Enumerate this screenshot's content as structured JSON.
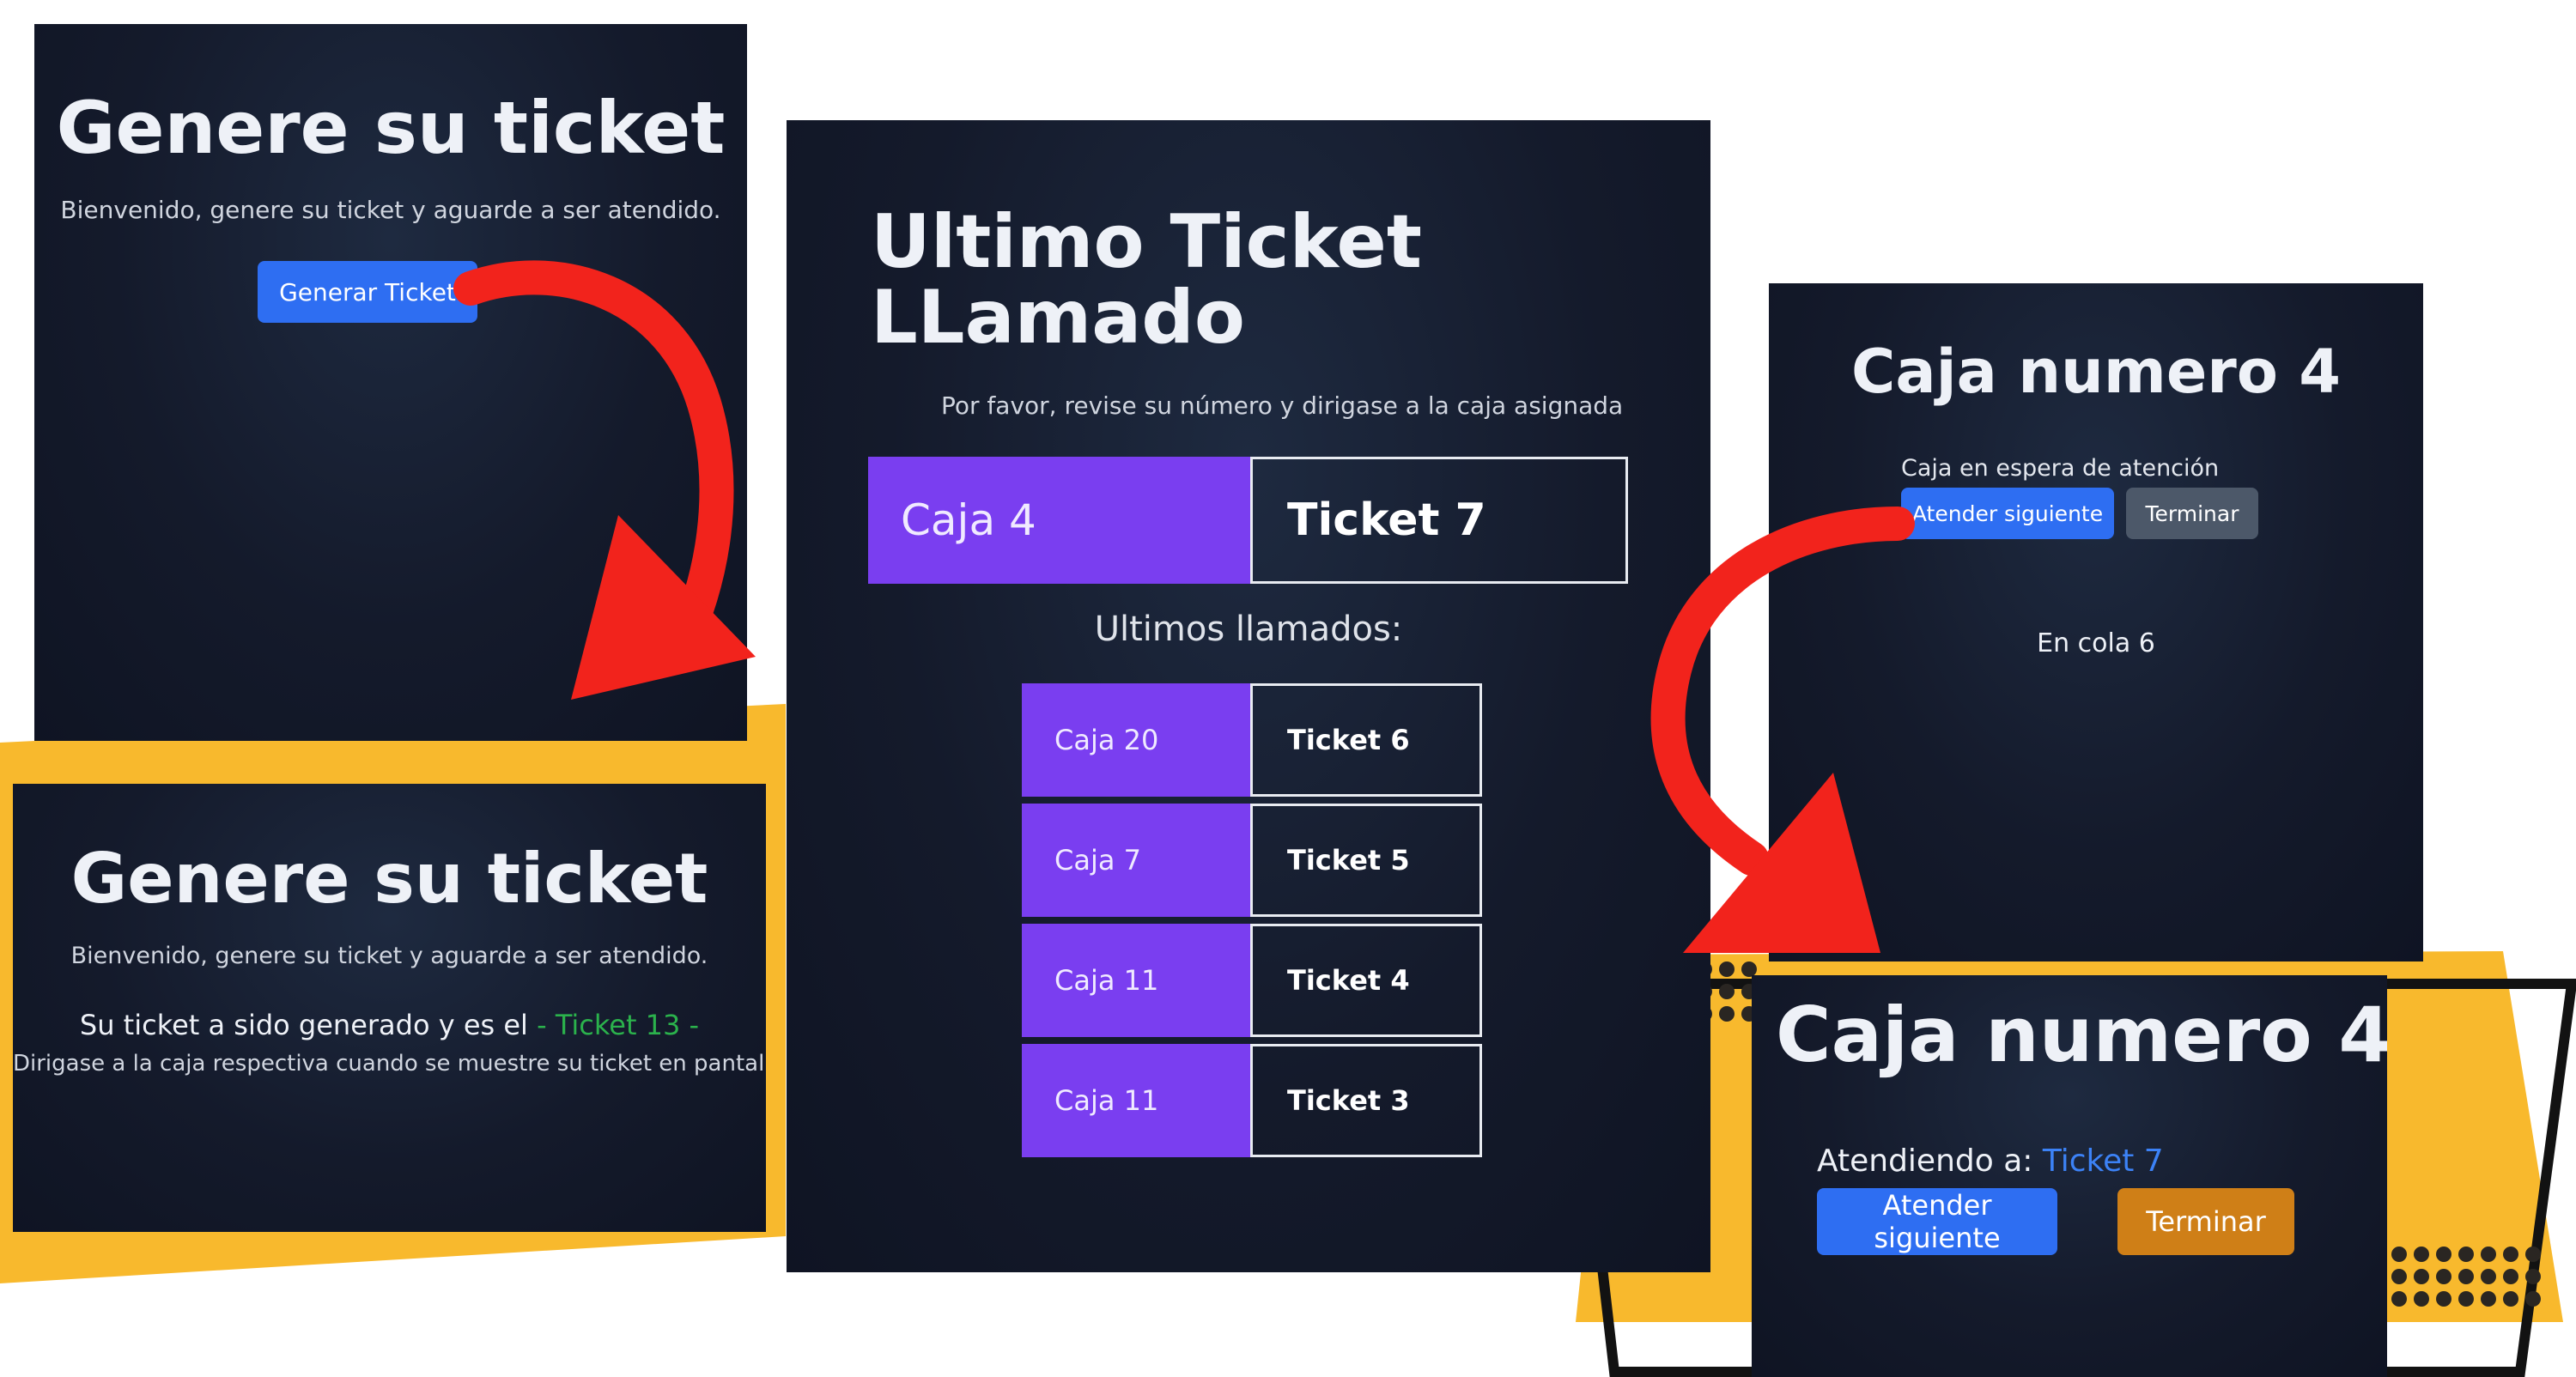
{
  "generate_panel": {
    "title": "Genere su ticket",
    "subtitle": "Bienvenido, genere su ticket y aguarde a ser atendido.",
    "button_label": "Generar Ticket"
  },
  "generated_panel": {
    "title": "Genere su ticket",
    "subtitle": "Bienvenido, genere su ticket y aguarde a ser atendido.",
    "message_prefix": "Su ticket a sido generado y es el",
    "ticket_label": "- Ticket 13 -",
    "instructions": "Dirigase a la caja respectiva cuando se muestre su ticket en pantalla"
  },
  "display_panel": {
    "title_line1": "Ultimo Ticket",
    "title_line2": "LLamado",
    "subtitle": "Por favor, revise su número y dirigase a la caja asignada",
    "current": {
      "caja": "Caja 4",
      "ticket": "Ticket 7"
    },
    "history_heading": "Ultimos llamados:",
    "history": [
      {
        "caja": "Caja 20",
        "ticket": "Ticket 6"
      },
      {
        "caja": "Caja 7",
        "ticket": "Ticket 5"
      },
      {
        "caja": "Caja 11",
        "ticket": "Ticket 4"
      },
      {
        "caja": "Caja 11",
        "ticket": "Ticket 3"
      }
    ]
  },
  "desk_panel": {
    "title": "Caja numero 4",
    "status": "Caja en espera de atención",
    "next_button": "Atender siguiente",
    "finish_button": "Terminar",
    "queue": "En cola 6"
  },
  "desk_attending_panel": {
    "title": "Caja numero 4",
    "attending_prefix": "Atendiendo a:",
    "attending_ticket": "Ticket 7",
    "next_button": "Atender siguiente",
    "finish_button": "Terminar"
  },
  "colors": {
    "accent_purple": "#7a3ef0",
    "primary_blue": "#2e6ef2",
    "warning_orange": "#cf7f17",
    "arrow_red": "#f2231c",
    "frame_yellow": "#f8b92d",
    "ticket_green": "#2bb24c"
  }
}
